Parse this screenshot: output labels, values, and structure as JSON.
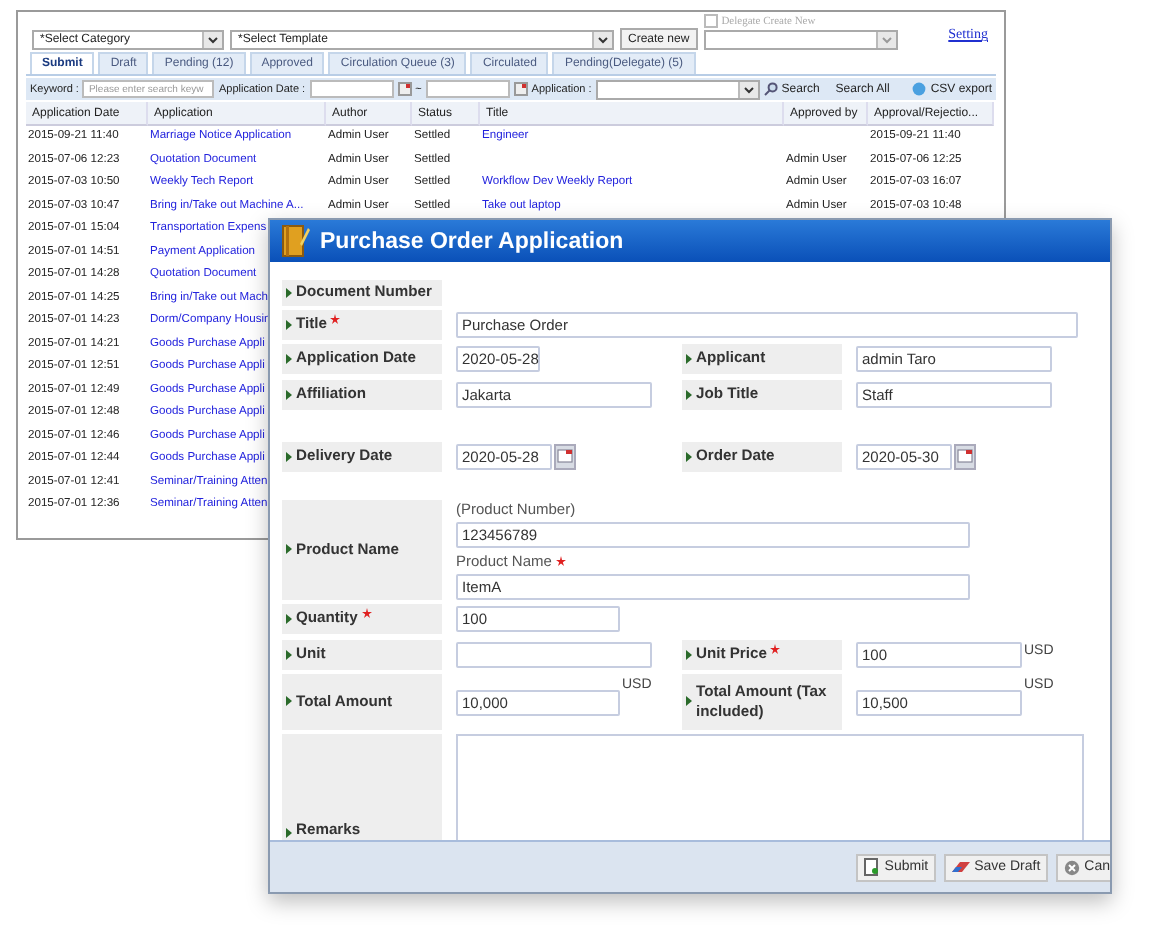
{
  "list_window": {
    "category_select": {
      "value": "*Select Category"
    },
    "template_select": {
      "value": "*Select Template"
    },
    "create_new_button": "Create new",
    "delegate": {
      "label": "Delegate Create New",
      "checked": false,
      "disabled": true
    },
    "setting_link": "Setting",
    "tabs": [
      {
        "label": "Submit",
        "selected": true
      },
      {
        "label": "Draft",
        "selected": false
      },
      {
        "label": "Pending (12)",
        "selected": false
      },
      {
        "label": "Approved",
        "selected": false
      },
      {
        "label": "Circulation Queue (3)",
        "selected": false
      },
      {
        "label": "Circulated",
        "selected": false
      },
      {
        "label": "Pending(Delegate) (5)",
        "selected": false
      }
    ],
    "search": {
      "keyword_label": "Keyword :",
      "keyword_placeholder": "Please enter search keyw",
      "date_label": "Application Date :",
      "range_separator": "~",
      "application_label": "Application :",
      "search_button": "Search",
      "search_all_button": "Search All",
      "csv_button": "CSV export"
    },
    "table": {
      "columns": [
        "Application Date",
        "Application",
        "Author",
        "Status",
        "Title",
        "Approved by",
        "Approval/Rejectio..."
      ],
      "rows": [
        [
          "2015-09-21 11:40",
          "Marriage Notice Application",
          "Admin User",
          "Settled",
          "Engineer",
          null,
          "2015-09-21 11:40"
        ],
        [
          "2015-07-06 12:23",
          "Quotation Document",
          "Admin User",
          "Settled",
          null,
          "Admin User",
          "2015-07-06 12:25"
        ],
        [
          "2015-07-03 10:50",
          "Weekly Tech Report",
          "Admin User",
          "Settled",
          "Workflow Dev Weekly Report",
          "Admin User",
          "2015-07-03 16:07"
        ],
        [
          "2015-07-03 10:47",
          "Bring in/Take out Machine A...",
          "Admin User",
          "Settled",
          "Take out laptop",
          "Admin User",
          "2015-07-03 10:48"
        ],
        [
          "2015-07-01 15:04",
          "Transportation Expens"
        ],
        [
          "2015-07-01 14:51",
          "Payment Application"
        ],
        [
          "2015-07-01 14:28",
          "Quotation Document"
        ],
        [
          "2015-07-01 14:25",
          "Bring in/Take out Mach"
        ],
        [
          "2015-07-01 14:23",
          "Dorm/Company Housin"
        ],
        [
          "2015-07-01 14:21",
          "Goods Purchase Appli"
        ],
        [
          "2015-07-01 12:51",
          "Goods Purchase Appli"
        ],
        [
          "2015-07-01 12:49",
          "Goods Purchase Appli"
        ],
        [
          "2015-07-01 12:48",
          "Goods Purchase Appli"
        ],
        [
          "2015-07-01 12:46",
          "Goods Purchase Appli"
        ],
        [
          "2015-07-01 12:44",
          "Goods Purchase Appli"
        ],
        [
          "2015-07-01 12:41",
          "Seminar/Training Atten"
        ],
        [
          "2015-07-01 12:36",
          "Seminar/Training Atten"
        ]
      ]
    }
  },
  "form_window": {
    "title": "Purchase Order Application",
    "document_number": {
      "label": "Document Number"
    },
    "title_field": {
      "label": "Title",
      "required": true,
      "value": "Purchase Order"
    },
    "application_date": {
      "label": "Application Date",
      "value": "2020-05-28"
    },
    "applicant": {
      "label": "Applicant",
      "value": "admin Taro"
    },
    "affiliation": {
      "label": "Affiliation",
      "value": "Jakarta"
    },
    "job_title": {
      "label": "Job Title",
      "value": "Staff"
    },
    "delivery_date": {
      "label": "Delivery Date",
      "value": "2020-05-28"
    },
    "order_date": {
      "label": "Order Date",
      "value": "2020-05-30"
    },
    "product": {
      "label": "Product Name",
      "number_caption": "(Product Number)",
      "number_value": "123456789",
      "name_caption": "Product Name",
      "name_required": true,
      "name_value": "ItemA"
    },
    "quantity": {
      "label": "Quantity",
      "required": true,
      "value": "100"
    },
    "unit": {
      "label": "Unit"
    },
    "unit_price": {
      "label": "Unit Price",
      "required": true,
      "value": "100",
      "currency": "USD"
    },
    "total_amount": {
      "label": "Total Amount",
      "value": "10,000",
      "currency": "USD"
    },
    "total_with_tax": {
      "label": "Total Amount (Tax included)",
      "value": "10,500",
      "currency": "USD"
    },
    "remarks": {
      "label": "Remarks"
    },
    "buttons": [
      {
        "kind": "submit",
        "label": "Submit"
      },
      {
        "kind": "draft",
        "label": "Save Draft"
      },
      {
        "kind": "cancel",
        "label": "Can"
      }
    ]
  }
}
